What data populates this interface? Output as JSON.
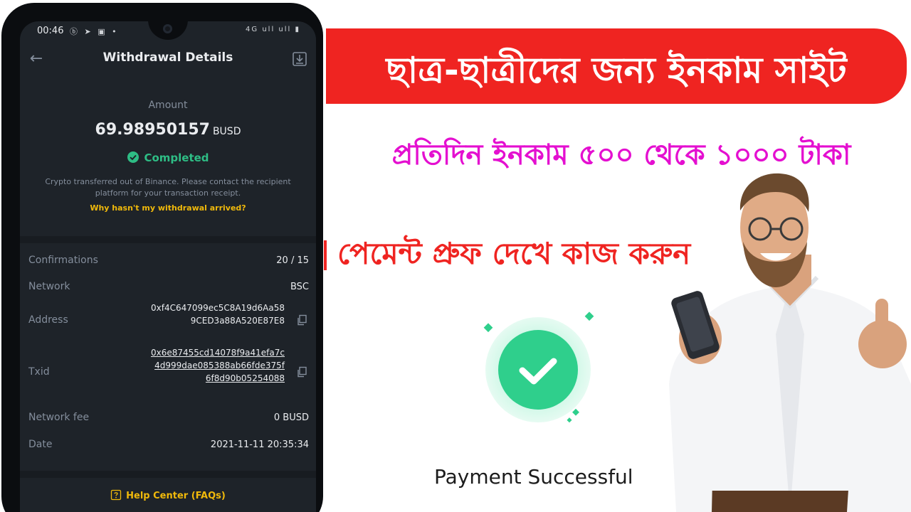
{
  "statusbar": {
    "time": "00:46",
    "icons": "ⓑ ➤ ▣ •",
    "right": "4G ull ull ▮"
  },
  "appbar": {
    "title": "Withdrawal Details"
  },
  "summary": {
    "amount_label": "Amount",
    "amount_value": "69.98950157",
    "amount_unit": "BUSD",
    "status": "Completed",
    "info": "Crypto transferred out of Binance. Please contact the recipient platform for your transaction receipt.",
    "why_link": "Why hasn't my withdrawal arrived?"
  },
  "details": {
    "confirmations_label": "Confirmations",
    "confirmations_value": "20 / 15",
    "network_label": "Network",
    "network_value": "BSC",
    "address_label": "Address",
    "address_line1": "0xf4C647099ec5C8A19d6Aa58",
    "address_line2": "9CED3a88A520E87E8",
    "txid_label": "Txid",
    "txid_line1": "0x6e87455cd14078f9a41efa7c",
    "txid_line2": "4d999dae085388ab66fde375f",
    "txid_line3": "6f8d90b05254088",
    "fee_label": "Network fee",
    "fee_value": "0 BUSD",
    "date_label": "Date",
    "date_value": "2021-11-11 20:35:34"
  },
  "help": {
    "label": "Help Center (FAQs)"
  },
  "banner": {
    "headline": "ছাত্র-ছাত্রীদের জন্য ইনকাম সাইট",
    "subline": "প্রতিদিন ইনকাম ৫০০ থেকে ১০০০ টাকা",
    "proof_line": "পেমেন্ট প্রুফ দেখে কাজ করুন",
    "payment_success": "Payment Successful"
  },
  "colors": {
    "binance_yellow": "#f0b90b",
    "success_green": "#2ebd85",
    "banner_red": "#ef2421",
    "magenta": "#e40fd0"
  }
}
